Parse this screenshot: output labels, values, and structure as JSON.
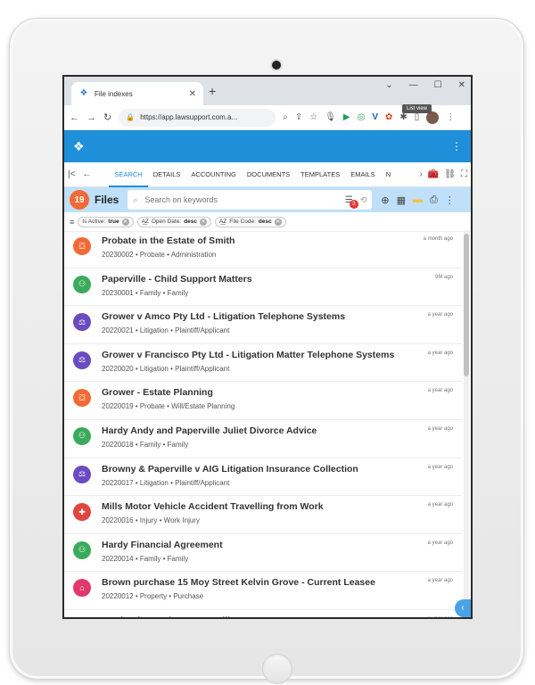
{
  "browser": {
    "tab_title": "File indexes",
    "url": "https://app.lawsupport.com.a...",
    "window_controls": [
      "⌄",
      "—",
      "☐",
      "✕"
    ]
  },
  "nav": {
    "items": [
      "SEARCH",
      "DETAILS",
      "ACCOUNTING",
      "DOCUMENTS",
      "TEMPLATES",
      "EMAILS",
      "N"
    ],
    "active": "SEARCH"
  },
  "toolbar": {
    "count": "19",
    "title": "Files",
    "search_placeholder": "Search on keywords",
    "filter_badge": "3",
    "tooltip": "List view"
  },
  "chips": [
    {
      "label": "Is Active:",
      "value": "true"
    },
    {
      "label": "Open Date:",
      "value": "desc"
    },
    {
      "label": "File Code:",
      "value": "desc"
    }
  ],
  "colors": {
    "probate": "#f16a35",
    "family": "#3bab5b",
    "litigation": "#6b4bc0",
    "injury": "#e0463e",
    "property": "#e0386b",
    "header": "#1e8fd8"
  },
  "files": [
    {
      "title": "Probate in the Estate of Smith",
      "code": "20230002",
      "type": "Probate",
      "sub": "Administration",
      "time": "a month ago",
      "icon": "probate"
    },
    {
      "title": "Paperville - Child Support Matters",
      "code": "20230001",
      "type": "Family",
      "sub": "Family",
      "time": "9M ago",
      "icon": "family"
    },
    {
      "title": "Grower v Amco Pty Ltd - Litigation Telephone Systems",
      "code": "20220021",
      "type": "Litigation",
      "sub": "Plaintiff/Applicant",
      "time": "a year ago",
      "icon": "litigation"
    },
    {
      "title": "Grower v Francisco Pty Ltd - Litigation Matter Telephone Systems",
      "code": "20220020",
      "type": "Litigation",
      "sub": "Plaintiff/Applicant",
      "time": "a year ago",
      "icon": "litigation"
    },
    {
      "title": "Grower - Estate Planning",
      "code": "20220019",
      "type": "Probate",
      "sub": "Will/Estate Planning",
      "time": "a year ago",
      "icon": "probate"
    },
    {
      "title": "Hardy Andy and Paperville Juliet Divorce Advice",
      "code": "20220018",
      "type": "Family",
      "sub": "Family",
      "time": "a year ago",
      "icon": "family"
    },
    {
      "title": "Browny & Paperville v AIG Litigation Insurance Collection",
      "code": "20220017",
      "type": "Litigation",
      "sub": "Plaintiff/Applicant",
      "time": "a year ago",
      "icon": "litigation"
    },
    {
      "title": "Mills Motor Vehicle Accident Travelling from Work",
      "code": "20220016",
      "type": "Injury",
      "sub": "Work Injury",
      "time": "a year ago",
      "icon": "injury"
    },
    {
      "title": "Hardy Financial Agreement",
      "code": "20220014",
      "type": "Family",
      "sub": "Family",
      "time": "a year ago",
      "icon": "family"
    },
    {
      "title": "Brown purchase 15 Moy Street Kelvin Grove - Current Leasee",
      "code": "20220012",
      "type": "Property",
      "sub": "Purchase",
      "time": "a year ago",
      "icon": "property"
    },
    {
      "title": "Hardy Divorce from Paperville",
      "code": "",
      "type": "",
      "sub": "",
      "time": "a year ago",
      "icon": "family"
    }
  ]
}
